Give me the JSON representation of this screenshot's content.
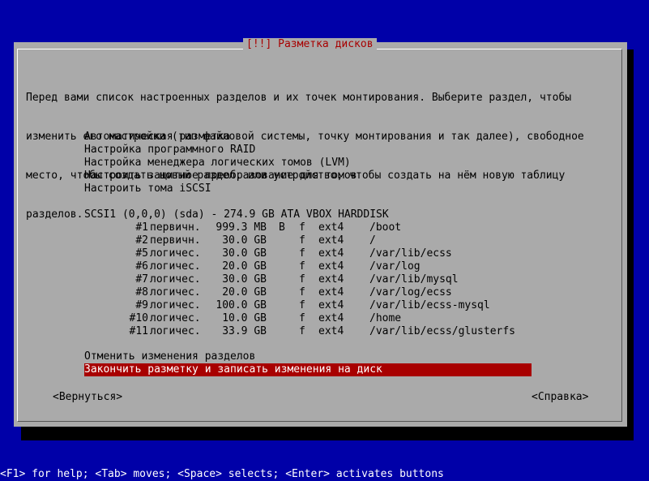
{
  "dialog": {
    "title": "[!!] Разметка дисков",
    "description": [
      "Перед вами список настроенных разделов и их точек монтирования. Выберите раздел, чтобы",
      "изменить его настройки (тип файловой системы, точку монтирования и так далее), свободное",
      "место, чтобы создать новый раздел, или устройство, чтобы создать на нём новую таблицу",
      "разделов."
    ],
    "menu": [
      "Автоматическая разметка",
      "Настройка программного RAID",
      "Настройка менеджера логических томов (LVM)",
      "Настроить защитное преобразование для томов",
      "Настроить тома iSCSI"
    ],
    "disk": "SCSI1 (0,0,0) (sda) - 274.9 GB ATA VBOX HARDDISK",
    "partitions": [
      {
        "num": "#1",
        "type": "первичн.",
        "size": "999.3 MB",
        "boot": "B",
        "fmt": "f",
        "fs": "ext4",
        "mount": "/boot"
      },
      {
        "num": "#2",
        "type": "первичн.",
        "size": "30.0 GB",
        "boot": "",
        "fmt": "f",
        "fs": "ext4",
        "mount": "/"
      },
      {
        "num": "#5",
        "type": "логичес.",
        "size": "30.0 GB",
        "boot": "",
        "fmt": "f",
        "fs": "ext4",
        "mount": "/var/lib/ecss"
      },
      {
        "num": "#6",
        "type": "логичес.",
        "size": "20.0 GB",
        "boot": "",
        "fmt": "f",
        "fs": "ext4",
        "mount": "/var/log"
      },
      {
        "num": "#7",
        "type": "логичес.",
        "size": "30.0 GB",
        "boot": "",
        "fmt": "f",
        "fs": "ext4",
        "mount": "/var/lib/mysql"
      },
      {
        "num": "#8",
        "type": "логичес.",
        "size": "20.0 GB",
        "boot": "",
        "fmt": "f",
        "fs": "ext4",
        "mount": "/var/log/ecss"
      },
      {
        "num": "#9",
        "type": "логичес.",
        "size": "100.0 GB",
        "boot": "",
        "fmt": "f",
        "fs": "ext4",
        "mount": "/var/lib/ecss-mysql"
      },
      {
        "num": "#10",
        "type": "логичес.",
        "size": "10.0 GB",
        "boot": "",
        "fmt": "f",
        "fs": "ext4",
        "mount": "/home"
      },
      {
        "num": "#11",
        "type": "логичес.",
        "size": "33.9 GB",
        "boot": "",
        "fmt": "f",
        "fs": "ext4",
        "mount": "/var/lib/ecss/glusterfs"
      }
    ],
    "undo": "Отменить изменения разделов",
    "finish": "Закончить разметку и записать изменения на диск",
    "back_button": "<Вернуться>",
    "help_button": "<Справка>"
  },
  "status_bar": "<F1> for help; <Tab> moves; <Space> selects; <Enter> activates buttons",
  "colors": {
    "background": "#0000a8",
    "dialog": "#aaaaaa",
    "selection": "#a80000",
    "title_text": "#a80000"
  }
}
